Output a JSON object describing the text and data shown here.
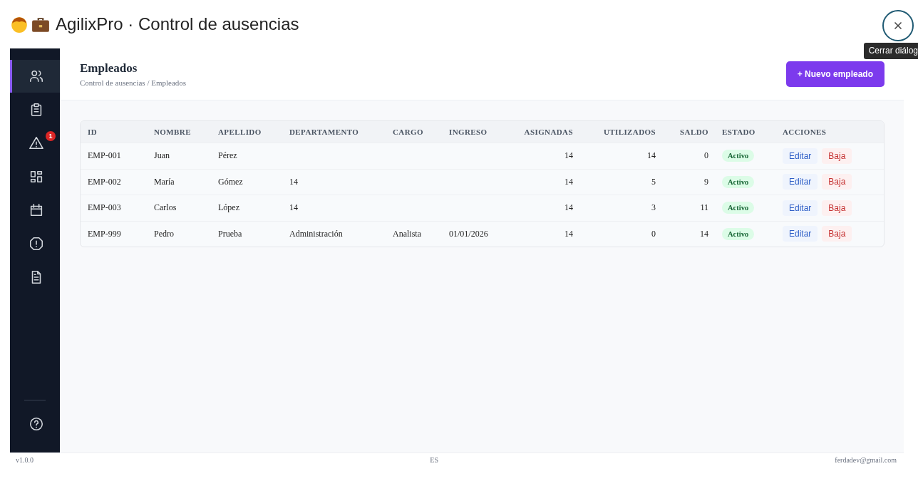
{
  "dialog": {
    "title": "AgilixPro · Control de ausencias",
    "close_tooltip": "Cerrar diálog"
  },
  "sidebar": {
    "items": [
      {
        "kind": "users",
        "selected": true
      },
      {
        "kind": "clipboard",
        "selected": false
      },
      {
        "kind": "warning",
        "selected": false,
        "badge": "1"
      },
      {
        "kind": "grid",
        "selected": false
      },
      {
        "kind": "calendar",
        "selected": false
      },
      {
        "kind": "alert",
        "selected": false
      },
      {
        "kind": "document",
        "selected": false
      }
    ],
    "bottom_items": [
      {
        "kind": "help",
        "selected": false
      }
    ]
  },
  "header": {
    "title": "Empleados",
    "breadcrumb": "Control de ausencias / Empleados",
    "primary_button": "+ Nuevo empleado"
  },
  "table": {
    "columns": [
      "ID",
      "NOMBRE",
      "APELLIDO",
      "DEPARTAMENTO",
      "CARGO",
      "INGRESO",
      "ASIGNADAS",
      "UTILIZADOS",
      "SALDO",
      "ESTADO",
      "ACCIONES"
    ],
    "rows": [
      {
        "cells": [
          "EMP-001",
          "Juan",
          "Pérez",
          "",
          "",
          "",
          "14",
          "14",
          "0"
        ],
        "status": "Activo",
        "actions": [
          "Editar",
          "Baja"
        ]
      },
      {
        "cells": [
          "EMP-002",
          "María",
          "Gómez",
          "14",
          "",
          "",
          "14",
          "5",
          "9"
        ],
        "status": "Activo",
        "actions": [
          "Editar",
          "Baja"
        ]
      },
      {
        "cells": [
          "EMP-003",
          "Carlos",
          "López",
          "14",
          "",
          "",
          "14",
          "3",
          "11"
        ],
        "status": "Activo",
        "actions": [
          "Editar",
          "Baja"
        ]
      },
      {
        "cells": [
          "EMP-999",
          "Pedro",
          "Prueba",
          "Administración",
          "Analista",
          "01/01/2026",
          "14",
          "0",
          "14"
        ],
        "status": "Activo",
        "actions": [
          "Editar",
          "Baja"
        ]
      }
    ]
  },
  "footer": {
    "version": "v1.0.0",
    "language": "ES",
    "email": "ferdadev@gmail.com"
  }
}
